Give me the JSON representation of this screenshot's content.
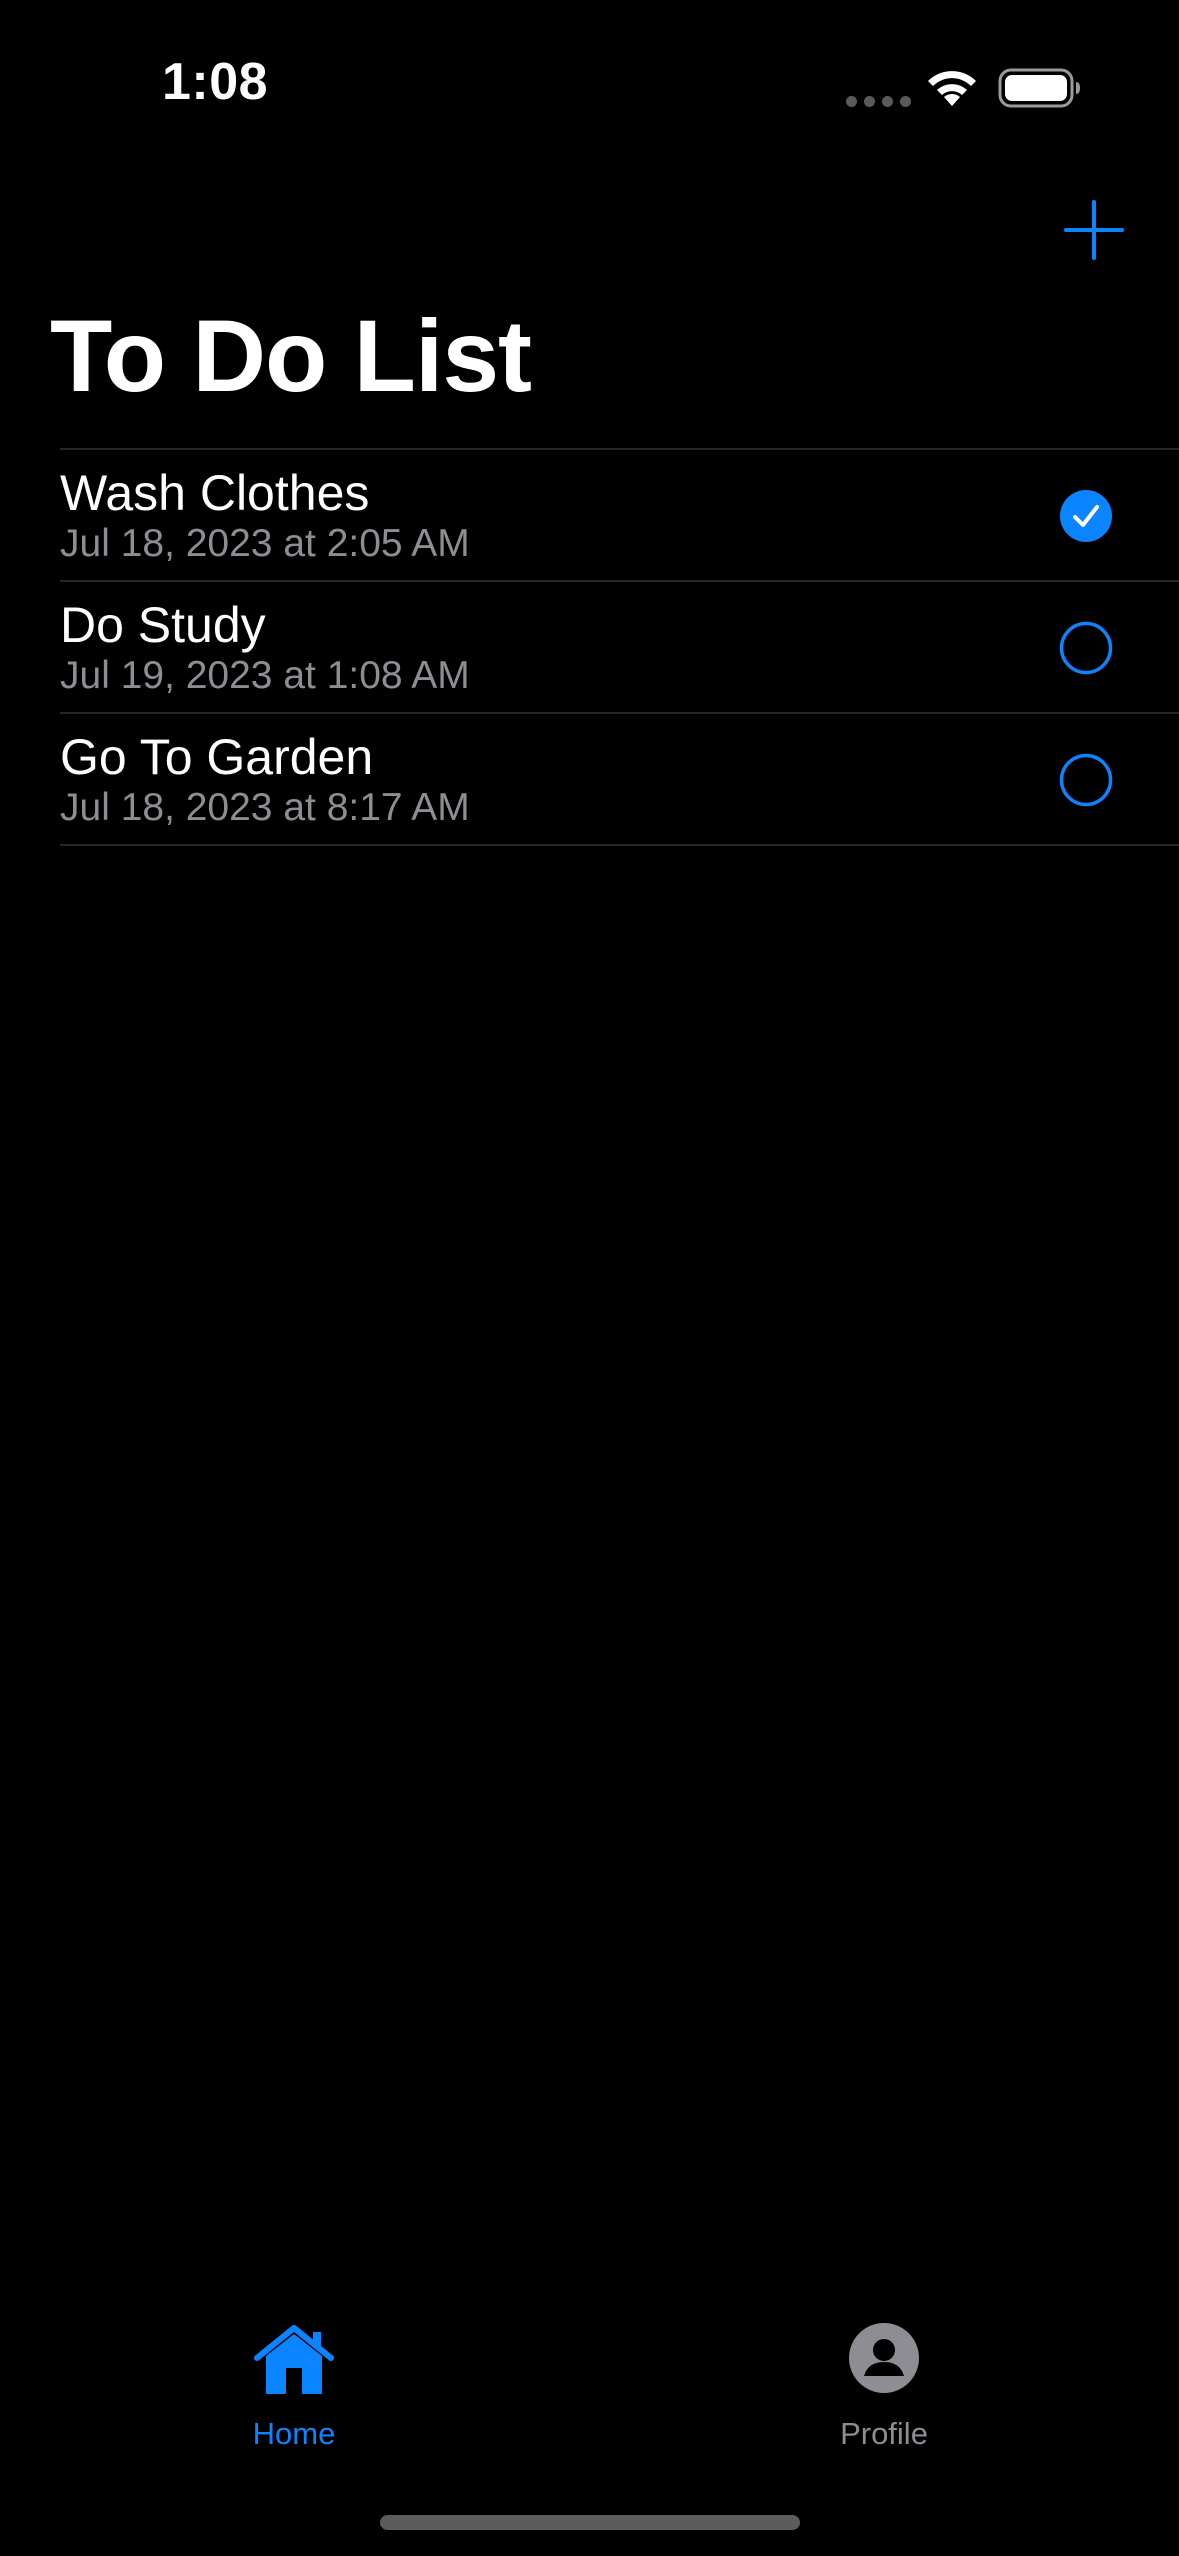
{
  "status_bar": {
    "time": "1:08"
  },
  "nav": {
    "title": "To Do List"
  },
  "todos": [
    {
      "title": "Wash Clothes",
      "date": "Jul 18, 2023 at 2:05 AM",
      "completed": true
    },
    {
      "title": "Do Study",
      "date": "Jul 19, 2023 at 1:08 AM",
      "completed": false
    },
    {
      "title": "Go To Garden",
      "date": "Jul 18, 2023 at 8:17 AM",
      "completed": false
    }
  ],
  "tab_bar": {
    "tabs": [
      {
        "label": "Home",
        "icon": "house-icon",
        "selected": true
      },
      {
        "label": "Profile",
        "icon": "person-circle-icon",
        "selected": false
      }
    ]
  },
  "colors": {
    "accent": "#0a84ff",
    "background": "#000000",
    "secondary_text": "#8d8d93",
    "separator": "#262626"
  }
}
